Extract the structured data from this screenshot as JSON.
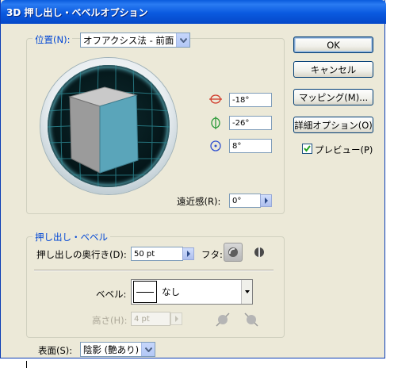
{
  "window": {
    "title": "3D 押し出し・ベベルオプション"
  },
  "position": {
    "legend": "位置",
    "select_label": "位置(N):",
    "select_value": "オフアクシス法 - 前面",
    "rot_x": "-18°",
    "rot_y": "-26°",
    "rot_z": "8°",
    "perspective_label": "遠近感(R):",
    "perspective_value": "0°"
  },
  "buttons": {
    "ok": "OK",
    "cancel": "キャンセル",
    "mapping": "マッピング(M)...",
    "detail": "詳細オプション(O)",
    "preview": "プレビュー(P)"
  },
  "extrude": {
    "legend": "押し出し・ベベル",
    "depth_label": "押し出しの奥行き(D):",
    "depth_value": "50 pt",
    "cap_label": "フタ:",
    "bevel_label": "ベベル:",
    "bevel_value": "なし",
    "height_label": "高さ(H):",
    "height_value": "4 pt"
  },
  "surface": {
    "label": "表面(S):",
    "value": "陰影 (艶あり)"
  },
  "colors": {
    "cube_front": "#5aa5ba",
    "cube_top": "#c9c9c9",
    "cube_side": "#9b9b9b",
    "grid": "#2d8a95"
  }
}
